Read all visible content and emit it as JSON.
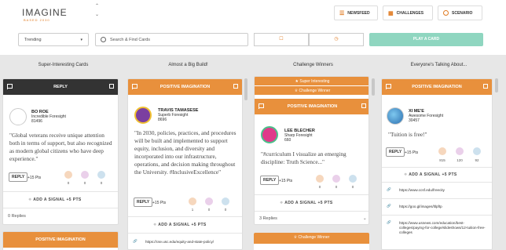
{
  "brand": {
    "logo": "IMAGINE",
    "tagline": "BASED 2030"
  },
  "nav": {
    "newsfeed": "NEWSFEED",
    "challenges": "CHALLENGES",
    "scenario": "SCENARIO"
  },
  "filters": {
    "sort": "Trending",
    "search_placeholder": "Search & Find Cards",
    "play": "PLAY A CARD"
  },
  "columns": [
    {
      "title": "Super-Interesting Cards"
    },
    {
      "title": "Almost a Big Build!"
    },
    {
      "title": "Challenge Winners"
    },
    {
      "title": "Everyone's Talking About..."
    }
  ],
  "cards": {
    "c1": {
      "header": "REPLY",
      "name": "BO ROE",
      "role": "Incredible Foresight",
      "score": "81496",
      "quote": "\"Global veterans receive unique attention both in terms of support, but also recognized as modern global citizens who have deep experience.\"",
      "reply": "REPLY",
      "pts": "+15 Pts",
      "reacts": [
        "0",
        "0",
        "0"
      ],
      "add": "ADD A SIGNAL +5 PTS",
      "replies": "0 Replies"
    },
    "c1b": {
      "header": "POSITIVE IMAGINATION"
    },
    "c2": {
      "header": "POSITIVE IMAGINATION",
      "name": "TRAVIS TAMASESE",
      "role": "Superb Foresight",
      "score": "8696",
      "quote": "\"In 2030, policies, practices, and procedures will be built and implemented to support equity, inclusion, and diversity and incorporated into our infrastructure, operations, and decision making throughout the University. #InclusiveExcellence\"",
      "reply": "REPLY",
      "pts": "+15 Pts",
      "reacts": [
        "1",
        "0",
        "0"
      ],
      "add": "ADD A SIGNAL +5 PTS",
      "link": "https://cse.usc.edu/equity-and-state-policy/"
    },
    "c3": {
      "badge1": "★ Super Interesting",
      "badge2": "♕ Challenge Winner",
      "header": "POSITIVE IMAGINATION",
      "name": "LEE BLECHER",
      "role": "Sharp Foresight",
      "score": "660",
      "quote": "\"#curriculum I visualize an emerging discipline: Truth Science...\"",
      "reply": "REPLY",
      "pts": "+15 Pts",
      "reacts": [
        "0",
        "0",
        "0"
      ],
      "add": "ADD A SIGNAL +5 PTS",
      "replies": "3 Replies",
      "badge3": "♕ Challenge Winner"
    },
    "c4": {
      "header": "POSITIVE IMAGINATION",
      "name": "XI ME'E",
      "role": "Awesome Foresight",
      "score": "30457",
      "quote": "\"Tuition is free!\"",
      "reply": "REPLY",
      "pts": "+15 Pts",
      "reacts": [
        "815",
        "120",
        "92"
      ],
      "add": "ADD A SIGNAL +5 PTS",
      "links": [
        "https://www.ccsf.edu/freecity",
        "https://goo.gl/images/ltlpftp",
        "https://www.usnews.com/education/best-colleges/paying-for-college/slideshows/12-tuition-free-colleges"
      ]
    }
  },
  "colors": {
    "orange": "#e8903c",
    "dark": "#333333",
    "teal": "#8fd6c0"
  }
}
